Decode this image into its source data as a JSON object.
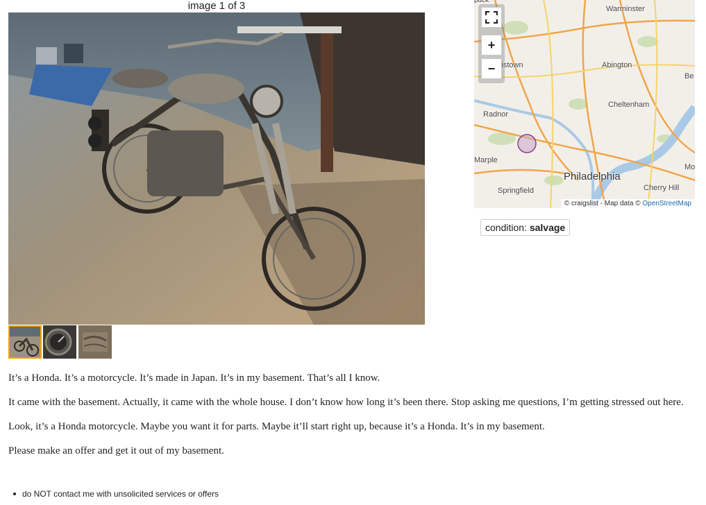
{
  "gallery": {
    "counter": "image 1 of 3",
    "thumbnails": [
      {
        "name": "motorcycle",
        "selected": true
      },
      {
        "name": "gauge",
        "selected": false
      },
      {
        "name": "engine-detail",
        "selected": false
      }
    ]
  },
  "map": {
    "fullscreen_icon": "fullscreen-icon",
    "zoom_in_label": "+",
    "zoom_out_label": "−",
    "places": {
      "warminster": "Warminster",
      "norristown": "Norristown",
      "abington": "Abington",
      "radnor": "Radnor",
      "cheltenham": "Cheltenham",
      "marple": "Marple",
      "philadelphia": "Philadelphia",
      "springfield": "Springfield",
      "cherry_hill": "Cherry Hill",
      "edge_be": "Be",
      "edge_mo": "Mo",
      "edge_top": "pack"
    },
    "attribution_text": "© craigslist - Map data © ",
    "attribution_link": "OpenStreetMap"
  },
  "attributes": {
    "condition_label": "condition: ",
    "condition_value": "salvage"
  },
  "posting": {
    "paragraphs": [
      "It’s a Honda. It’s a motorcycle. It’s made in Japan. It’s in my basement. That’s all I know.",
      "It came with the basement. Actually, it came with the whole house. I don’t know how long it’s been there. Stop asking me questions, I’m getting stressed out here.",
      "Look, it’s a Honda motorcycle. Maybe you want it for parts. Maybe it’ll start right up, because it’s a Honda. It’s in my basement.",
      "Please make an offer and get it out of my basement."
    ],
    "notices": [
      "do NOT contact me with unsolicited services or offers"
    ]
  }
}
